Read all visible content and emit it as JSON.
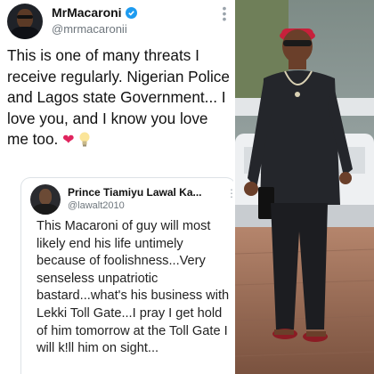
{
  "tweet": {
    "author_name": "MrMacaroni",
    "author_handle": "@mrmacaronii",
    "text": "This is one of many threats I receive regularly. Nigerian Police and Lagos state Government... I love you, and I know you love me too.",
    "icons": [
      "verified-badge-icon",
      "more-icon",
      "red-heart-emoji",
      "light-bulb-emoji"
    ]
  },
  "quoted_tweet": {
    "author_name": "Prince Tiamiyu Lawal Ka...",
    "author_handle": "@lawalt2010",
    "text": "This Macaroni of guy will most likely end his life untimely because of foolishness...Very senseless unpatriotic bastard...what's his business with Lekki Toll Gate...I pray I get hold of him tomorrow at the Toll Gate I will k!ll him on sight..."
  },
  "colors": {
    "verified": "#1d9bf0",
    "heart": "#e0245e",
    "text": "#111111",
    "handle": "#6e767d"
  }
}
